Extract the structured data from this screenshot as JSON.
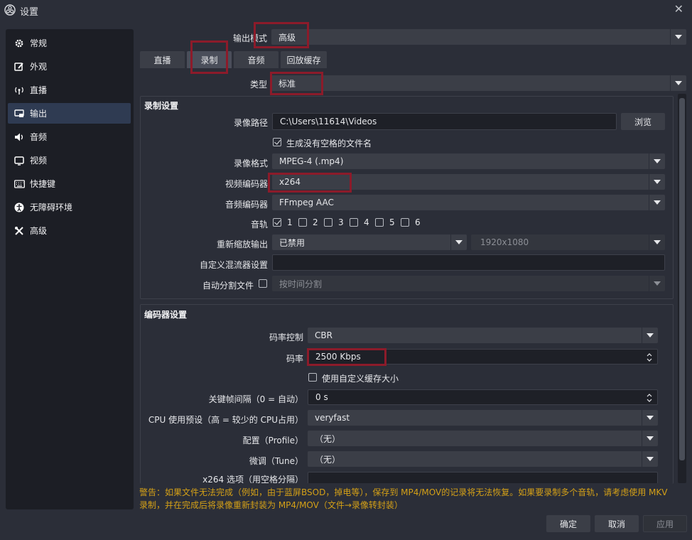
{
  "window": {
    "title": "设置"
  },
  "sidebar": {
    "items": [
      {
        "label": "常规",
        "icon": "gear-icon"
      },
      {
        "label": "外观",
        "icon": "appearance-icon"
      },
      {
        "label": "直播",
        "icon": "broadcast-icon"
      },
      {
        "label": "输出",
        "icon": "output-icon",
        "active": true
      },
      {
        "label": "音频",
        "icon": "speaker-icon"
      },
      {
        "label": "视频",
        "icon": "monitor-icon"
      },
      {
        "label": "快捷键",
        "icon": "keyboard-icon"
      },
      {
        "label": "无障碍环境",
        "icon": "accessibility-icon"
      },
      {
        "label": "高级",
        "icon": "tools-icon"
      }
    ]
  },
  "output_mode": {
    "label": "输出模式",
    "value": "高级"
  },
  "tabs": [
    {
      "label": "直播"
    },
    {
      "label": "录制",
      "active": true
    },
    {
      "label": "音频"
    },
    {
      "label": "回放缓存"
    }
  ],
  "type": {
    "label": "类型",
    "value": "标准"
  },
  "recording": {
    "title": "录制设置",
    "path_label": "录像路径",
    "path_value": "C:\\Users\\11614\\Videos",
    "browse_label": "浏览",
    "nospace_label": "生成没有空格的文件名",
    "nospace_checked": true,
    "format_label": "录像格式",
    "format_value": "MPEG-4 (.mp4)",
    "video_encoder_label": "视频编码器",
    "video_encoder_value": "x264",
    "audio_encoder_label": "音频编码器",
    "audio_encoder_value": "FFmpeg AAC",
    "tracks_label": "音轨",
    "tracks": [
      {
        "num": "1",
        "checked": true
      },
      {
        "num": "2",
        "checked": false
      },
      {
        "num": "3",
        "checked": false
      },
      {
        "num": "4",
        "checked": false
      },
      {
        "num": "5",
        "checked": false
      },
      {
        "num": "6",
        "checked": false
      }
    ],
    "rescale_label": "重新缩放输出",
    "rescale_value": "已禁用",
    "rescale_res": "1920x1080",
    "muxer_label": "自定义混流器设置",
    "muxer_value": "",
    "split_label": "自动分割文件",
    "split_value": "按时间分割"
  },
  "encoder": {
    "title": "编码器设置",
    "rate_control_label": "码率控制",
    "rate_control_value": "CBR",
    "bitrate_label": "码率",
    "bitrate_value": "2500 Kbps",
    "custom_buffer_label": "使用自定义缓存大小",
    "keyframe_label": "关键帧间隔（0 = 自动）",
    "keyframe_value": "0 s",
    "cpu_label": "CPU 使用预设（高 = 较少的 CPU占用）",
    "cpu_value": "veryfast",
    "profile_label": "配置（Profile）",
    "profile_value": "（无）",
    "tune_label": "微调（Tune）",
    "tune_value": "（无）",
    "x264opts_label": "x264 选项（用空格分隔）"
  },
  "warning": {
    "line1": "警告：如果文件无法完成（例如，由于蓝屏BSOD，掉电等），保存到 MP4/MOV的记录将无法恢复。如果要录制多个音轨，请考虑使用 MKV",
    "line2": "录制，并在完成后将录像重新封装为 MP4/MOV（文件→录像转封装）"
  },
  "buttons": {
    "ok": "确定",
    "cancel": "取消",
    "apply": "应用"
  },
  "colors": {
    "highlight": "#8c1b2a",
    "warning": "#d4a017",
    "active_item": "#2f3b52"
  }
}
